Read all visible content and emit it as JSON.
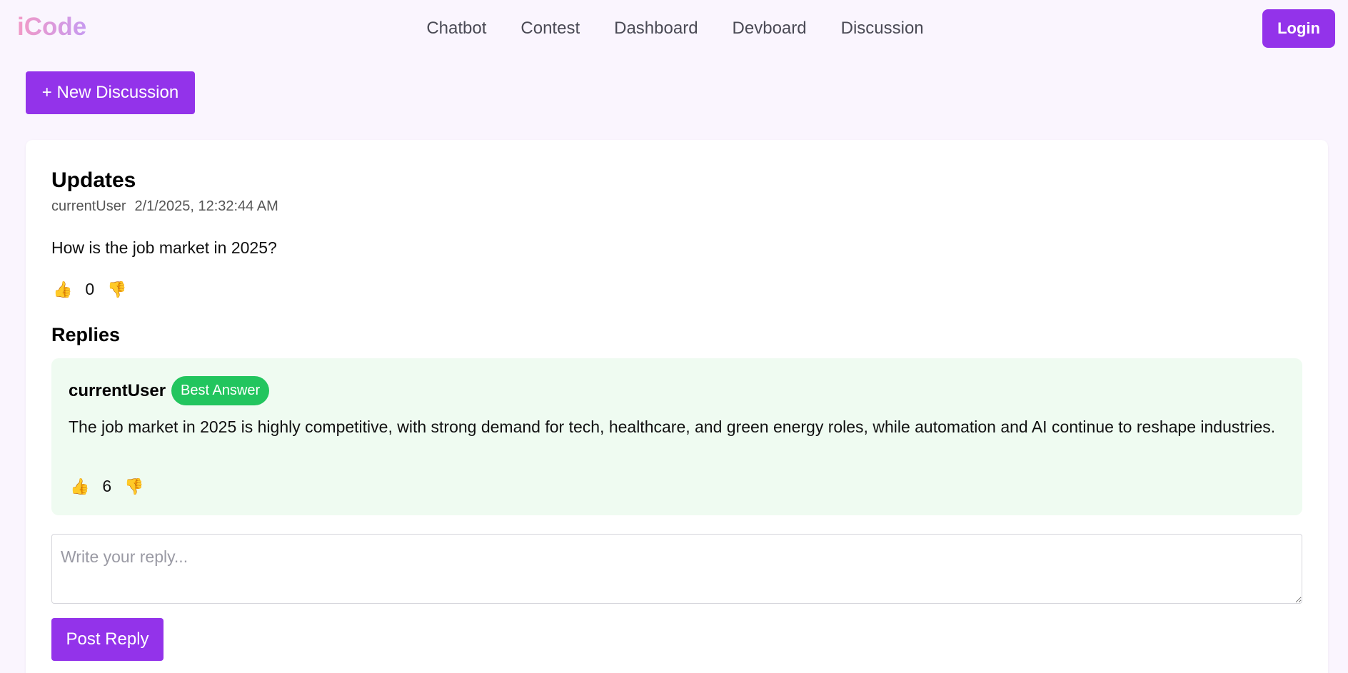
{
  "header": {
    "logo": "iCode",
    "nav": [
      "Chatbot",
      "Contest",
      "Dashboard",
      "Devboard",
      "Discussion"
    ],
    "login_label": "Login"
  },
  "actions": {
    "new_discussion_label": "+ New Discussion"
  },
  "post": {
    "title": "Updates",
    "author": "currentUser",
    "timestamp": "2/1/2025, 12:32:44 AM",
    "body": "How is the job market in 2025?",
    "votes": "0",
    "upvote_icon": "👍",
    "downvote_icon": "👎"
  },
  "replies": {
    "heading": "Replies",
    "items": [
      {
        "author": "currentUser",
        "badge": "Best Answer",
        "body": "The job market in 2025 is highly competitive, with strong demand for tech, healthcare, and green energy roles, while automation and AI continue to reshape industries.",
        "votes": "6",
        "upvote_icon": "👍",
        "downvote_icon": "👎"
      }
    ]
  },
  "reply_form": {
    "placeholder": "Write your reply...",
    "submit_label": "Post Reply"
  },
  "colors": {
    "accent": "#9333ea",
    "badge": "#22c55e",
    "reply_bg": "#effbf1",
    "page_bg": "#faf5fe"
  }
}
